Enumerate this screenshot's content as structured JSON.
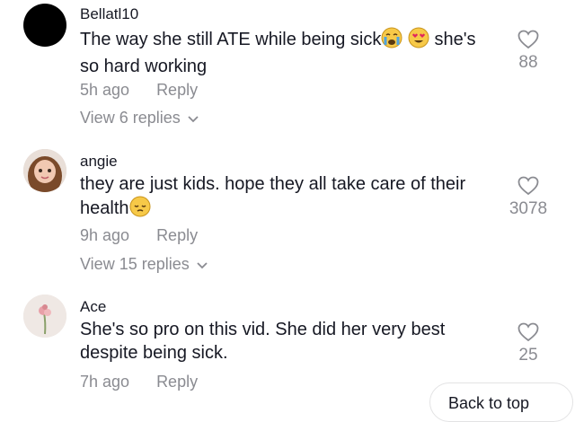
{
  "comments": [
    {
      "username": "Bellatl10",
      "text_before": "The way she still ATE while being sick",
      "emojis": [
        "crying-face-emoji",
        "heart-eyes-emoji"
      ],
      "text_after": " she's so hard working",
      "time": "5h ago",
      "reply_label": "Reply",
      "view_replies": "View 6 replies",
      "likes": "88"
    },
    {
      "username": "angie",
      "text_before": "they are just kids. hope they all take care of their health",
      "emojis": [
        "pensive-face-emoji"
      ],
      "text_after": "",
      "time": "9h ago",
      "reply_label": "Reply",
      "view_replies": "View 15 replies",
      "likes": "3078"
    },
    {
      "username": "Ace",
      "text_before": "She's so pro on this vid. She did her very best despite being sick.",
      "emojis": [],
      "text_after": "",
      "time": "7h ago",
      "reply_label": "Reply",
      "likes": "25"
    }
  ],
  "back_to_top": "Back to top",
  "colors": {
    "text": "#161823",
    "muted": "#8a8b91"
  }
}
